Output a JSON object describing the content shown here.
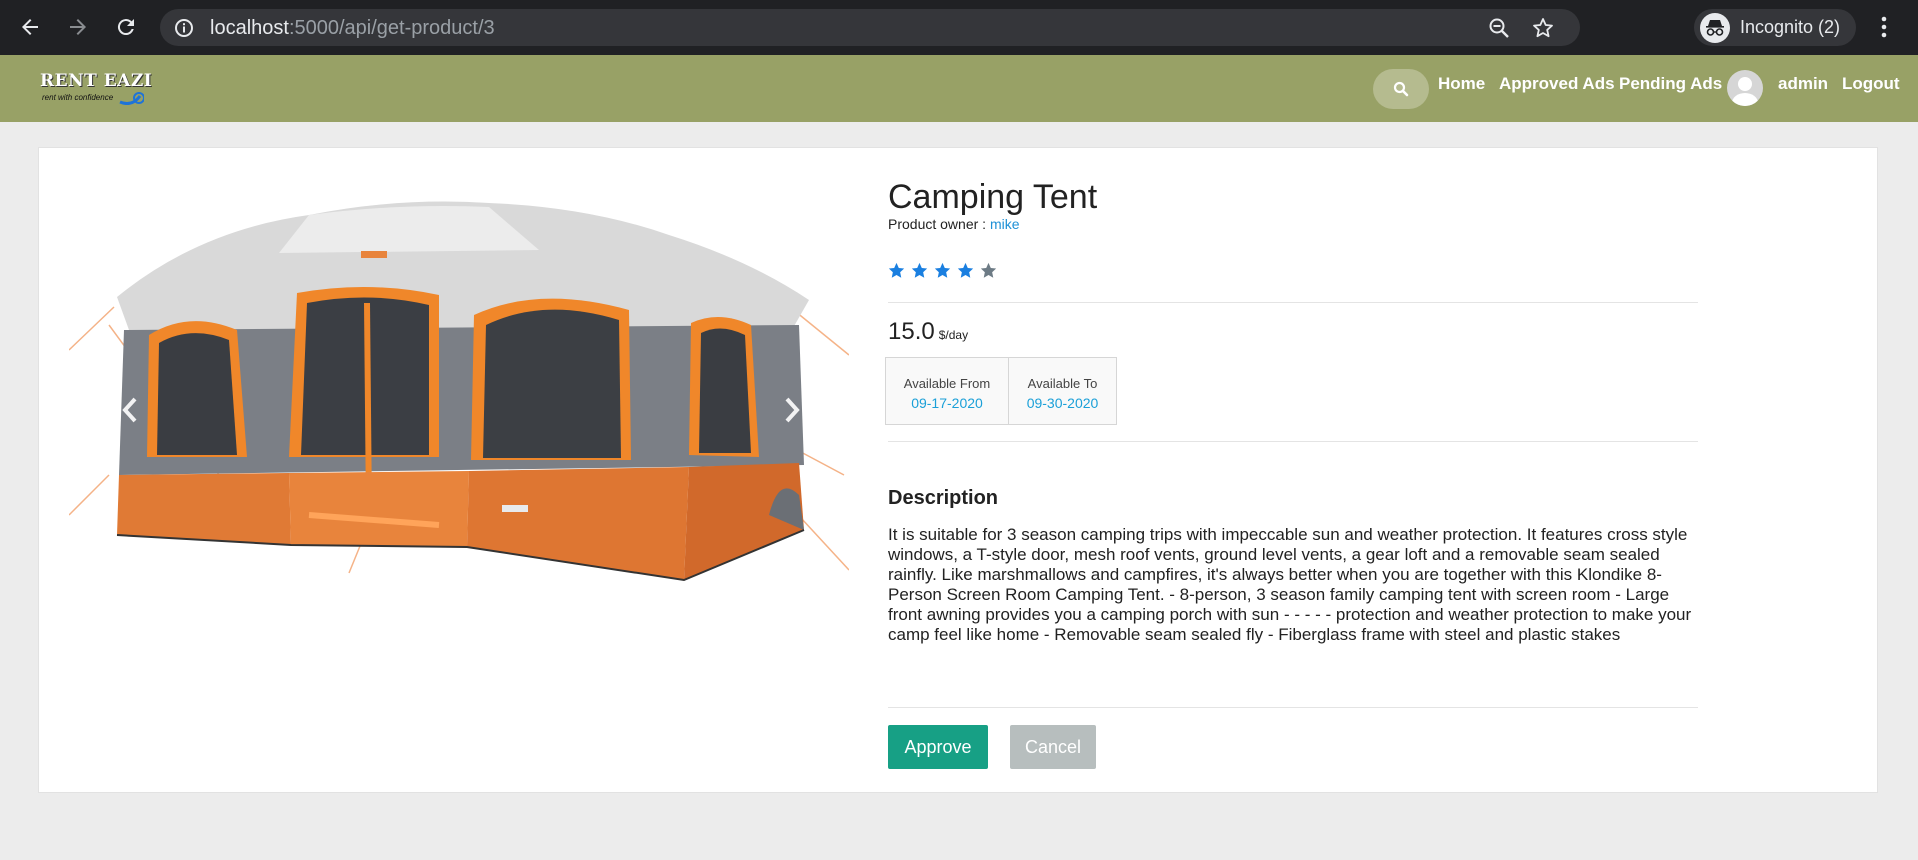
{
  "browser": {
    "url_host": "localhost",
    "url_path": ":5000/api/get-product/3",
    "incognito_label": "Incognito (2)"
  },
  "header": {
    "logo_title": "RENT EAZI",
    "logo_tagline": "rent with confidence",
    "nav": {
      "home": "Home",
      "approved": "Approved Ads",
      "pending": "Pending Ads",
      "user": "admin",
      "logout": "Logout"
    }
  },
  "product": {
    "title": "Camping Tent",
    "owner_label": "Product owner :",
    "owner_name": "mike",
    "rating": 4,
    "rating_max": 5,
    "price": "15.0",
    "price_unit": "$/day",
    "available_from_label": "Available From",
    "available_from": "09-17-2020",
    "available_to_label": "Available To",
    "available_to": "09-30-2020",
    "description_title": "Description",
    "description": "It is suitable for 3 season camping trips with impeccable sun and weather protection. It features cross style windows, a T-style door, mesh roof vents, ground level vents, a gear loft and a removable seam sealed rainfly. Like marshmallows and campfires, it's always better when you are together with this Klondike 8-Person Screen Room Camping Tent. - 8-person, 3 season family camping tent with screen room - Large front awning provides you a camping porch with sun - - - - - protection and weather protection to make your camp feel like home - Removable seam sealed fly - Fiberglass frame with steel and plastic stakes"
  },
  "actions": {
    "approve": "Approve",
    "cancel": "Cancel"
  },
  "colors": {
    "header_bg": "#98a166",
    "approve_bg": "#17a085",
    "cancel_bg": "#b7bebe",
    "link": "#1e90d6",
    "star_filled": "#1a7fe0",
    "star_empty": "#6d7b85"
  }
}
